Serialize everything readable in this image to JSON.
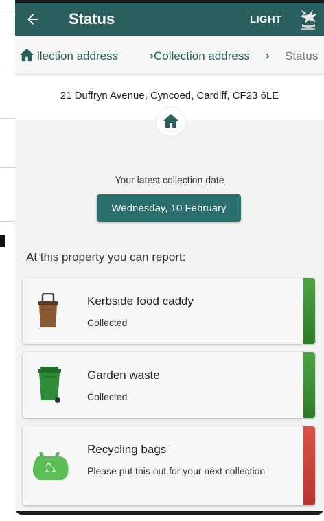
{
  "appbar": {
    "title": "Status",
    "theme_label": "LIGHT"
  },
  "breadcrumb": {
    "items": [
      "llection address",
      "Collection address",
      "Status"
    ]
  },
  "address": "21 Duffryn Avenue, Cyncoed, Cardiff, CF23 6LE",
  "latest": {
    "label": "Your latest collection date",
    "date": "Wednesday, 10 February"
  },
  "report": {
    "heading": "At this property you can report:",
    "items": [
      {
        "name": "Kerbside food caddy",
        "status": "Collected",
        "icon": "food-caddy-icon",
        "state_color": "#3e8c3a"
      },
      {
        "name": "Garden waste",
        "status": "Collected",
        "icon": "green-wheelie-bin-icon",
        "state_color": "#3e8c3a"
      },
      {
        "name": "Recycling bags",
        "status": "Please put this out for your next collection",
        "icon": "recycling-bag-icon",
        "state_color": "#c9403a"
      }
    ]
  },
  "colors": {
    "primary": "#2a5f5d",
    "button": "#2a6f6d",
    "collected": "#3e8c3a",
    "not_collected": "#c9403a"
  }
}
